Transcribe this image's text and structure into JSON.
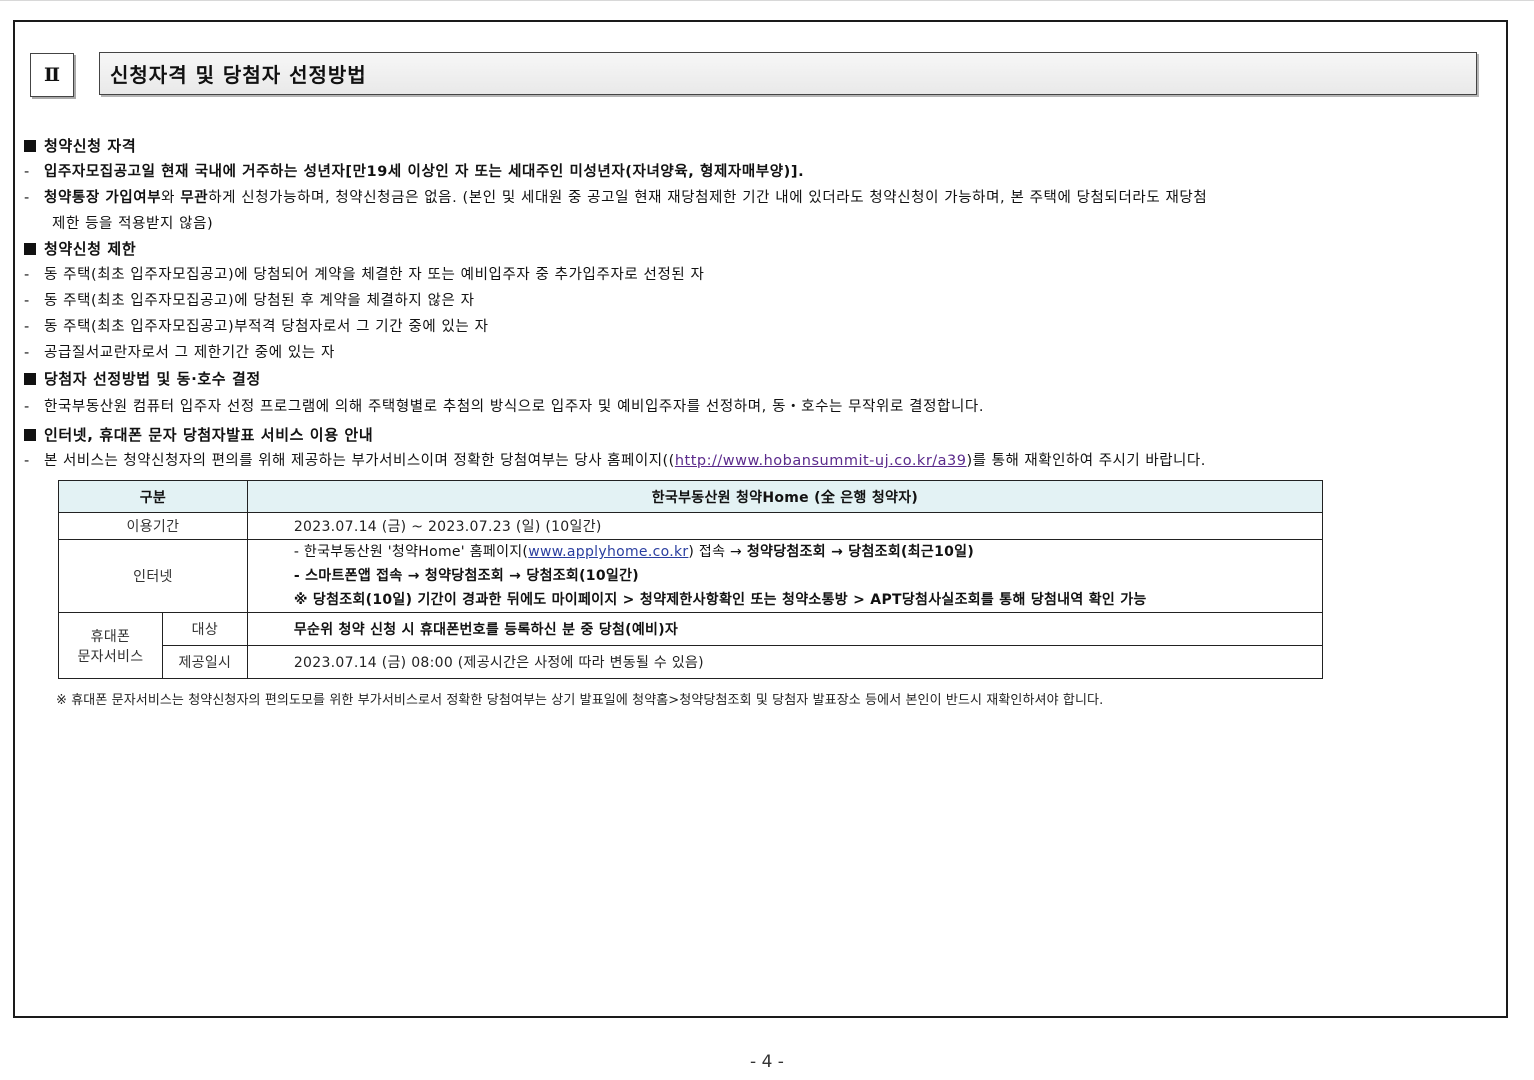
{
  "section": {
    "number": "Ⅱ",
    "title": "신청자격 및 당첨자 선정방법"
  },
  "qualification": {
    "heading": "청약신청 자격",
    "item1": "입주자모집공고일 현재 국내에 거주하는 성년자[만19세 이상인 자 또는 세대주인 미성년자(자녀양육, 형제자매부양)].",
    "item2_bold1": "청약통장 가입여부",
    "item2_t1": "와 ",
    "item2_bold2": "무관",
    "item2_t2": "하게 신청가능하며, 청약신청금은 없음. (본인 및 세대원 중 공고일 현재 재당첨제한 기간 내에 있더라도 청약신청이 가능하며, 본 주택에 당첨되더라도 재당첨",
    "item2_cont": "제한 등을 적용받지 않음)"
  },
  "restriction": {
    "heading": "청약신청 제한",
    "items": [
      "동 주택(최초 입주자모집공고)에 당첨되어 계약을 체결한 자 또는 예비입주자 중 추가입주자로 선정된 자",
      "동 주택(최초 입주자모집공고)에 당첨된 후 계약을 체결하지 않은 자",
      "동 주택(최초 입주자모집공고)부적격 당첨자로서 그 기간 중에 있는 자",
      "공급질서교란자로서 그 제한기간 중에 있는 자"
    ]
  },
  "selection": {
    "heading": "당첨자 선정방법 및 동·호수 결정",
    "item": "한국부동산원 컴퓨터 입주자 선정 프로그램에 의해 주택형별로 추첨의 방식으로 입주자 및 예비입주자를 선정하며, 동・호수는 무작위로 결정합니다."
  },
  "notice": {
    "heading": "인터넷, 휴대폰 문자 당첨자발표 서비스 이용 안내",
    "text_before": "본 서비스는 청약신청자의 편의를 위해 제공하는 부가서비스이며 정확한 당첨여부는 당사 홈페이지((",
    "url": "http://www.hobansummit-uj.co.kr/a39",
    "text_after": ")를 통해 재확인하여 주시기 바랍니다."
  },
  "table": {
    "header_col1": "구분",
    "header_col2": "한국부동산원 청약Home (全 은행 청약자)",
    "period_label": "이용기간",
    "period_value": "2023.07.14 (금) ~ 2023.07.23 (일) (10일간)",
    "internet_label": "인터넷",
    "internet_line1_a": "- 한국부동산원 '청약Home' 홈페이지(",
    "internet_line1_url": "www.applyhome.co.kr",
    "internet_line1_b": ") 접속 → ",
    "internet_line1_bold": "청약당첨조회 → 당첨조회(최근10일)",
    "internet_line2": "- 스마트폰앱 접속  → 청약당첨조회 → 당첨조회(10일간)",
    "internet_line3": "※ 당첨조회(10일) 기간이 경과한 뒤에도 마이페이지 > 청약제한사항확인 또는 청약소통방 > APT당첨사실조회를 통해 당첨내역 확인 가능",
    "sms_label_1": "휴대폰",
    "sms_label_2": "문자서비스",
    "target_label": "대상",
    "target_value": "무순위 청약 신청 시 휴대폰번호를 등록하신 분 중 당첨(예비)자",
    "time_label": "제공일시",
    "time_value": "2023.07.14 (금) 08:00 (제공시간은 사정에 따라 변동될 수 있음)"
  },
  "footnote": "※ 휴대폰 문자서비스는 청약신청자의 편의도모를 위한 부가서비스로서 정확한 당첨여부는 상기 발표일에 청약홈>청약당첨조회 및 당첨자 발표장소 등에서 본인이 반드시 재확인하셔야 합니다.",
  "page_number": "- 4 -"
}
